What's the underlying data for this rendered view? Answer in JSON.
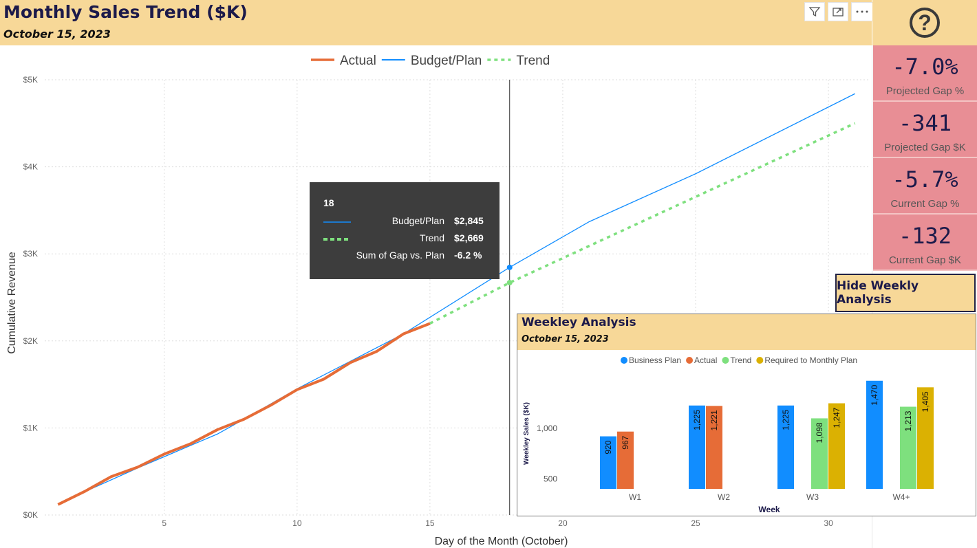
{
  "header": {
    "title": "Monthly Sales Trend ($K)",
    "subtitle": "October 15, 2023"
  },
  "toolbar": {
    "filter_icon": "filter-icon",
    "expand_icon": "focus-mode-icon",
    "more_icon": "more-options-icon"
  },
  "help": {
    "label": "?",
    "icon": "help-icon"
  },
  "kpis": [
    {
      "value": "-7.0%",
      "label": "Projected Gap %"
    },
    {
      "value": "-341",
      "label": "Projected Gap $K"
    },
    {
      "value": "-5.7%",
      "label": "Current Gap %"
    },
    {
      "value": "-132",
      "label": "Current Gap $K"
    }
  ],
  "hide_button": {
    "label": "Hide Weekly Analysis"
  },
  "tooltip": {
    "day": "18",
    "rows": [
      {
        "label": "Budget/Plan",
        "value": "$2,845"
      },
      {
        "label": "Trend",
        "value": "$2,669"
      },
      {
        "label": "Sum of Gap vs. Plan",
        "value": "-6.2 %"
      }
    ]
  },
  "colors": {
    "actual": "#e66c37",
    "plan": "#118dff",
    "trend": "#7ee07e",
    "required": "#dbb102",
    "header": "#f7d898",
    "kpi": "#e88e95"
  },
  "chart_data": [
    {
      "type": "line",
      "xlabel": "Day of the Month (October)",
      "ylabel": "Cumulative Revenue",
      "xlim": [
        0.5,
        31.5
      ],
      "ylim": [
        0,
        5000
      ],
      "x_ticks": [
        5,
        10,
        15,
        20,
        25,
        30
      ],
      "y_ticks": [
        {
          "value": 0,
          "label": "$0K"
        },
        {
          "value": 1000,
          "label": "$1K"
        },
        {
          "value": 2000,
          "label": "$2K"
        },
        {
          "value": 3000,
          "label": "$3K"
        },
        {
          "value": 4000,
          "label": "$4K"
        },
        {
          "value": 5000,
          "label": "$5K"
        }
      ],
      "grid": true,
      "legend": "top-center",
      "hover_day": 18,
      "series": [
        {
          "name": "Actual",
          "style": "solid-thick",
          "x": [
            1,
            2,
            3,
            4,
            5,
            6,
            7,
            8,
            9,
            10,
            11,
            12,
            13,
            14,
            15
          ],
          "values": [
            120,
            270,
            440,
            550,
            700,
            820,
            980,
            1100,
            1260,
            1440,
            1560,
            1750,
            1880,
            2080,
            2200
          ]
        },
        {
          "name": "Budget/Plan",
          "style": "solid",
          "x": [
            1,
            4,
            7,
            8,
            10,
            14,
            18,
            21,
            25,
            31
          ],
          "values": [
            130,
            540,
            930,
            1100,
            1450,
            2080,
            2845,
            3370,
            3920,
            4840
          ]
        },
        {
          "name": "Trend",
          "style": "dashed",
          "x": [
            15,
            18,
            31
          ],
          "values": [
            2200,
            2669,
            4500
          ]
        }
      ]
    },
    {
      "type": "bar",
      "title": "Weekley Analysis",
      "subtitle": "October 15, 2023",
      "xlabel": "Week",
      "ylabel": "Weekley Sales ($K)",
      "ylim": [
        400,
        1550
      ],
      "y_ticks": [
        500,
        1000
      ],
      "y_tick_labels": [
        "500",
        "1,000"
      ],
      "legend": "top-center",
      "categories": [
        "W1",
        "W2",
        "W3",
        "W4+"
      ],
      "series": [
        {
          "name": "Business Plan",
          "values": [
            920,
            1225,
            1225,
            1470
          ],
          "labels": [
            "920",
            "1,225",
            "1,225",
            "1,470"
          ]
        },
        {
          "name": "Actual",
          "values": [
            967,
            1221,
            null,
            null
          ],
          "labels": [
            "967",
            "1,221",
            "",
            ""
          ]
        },
        {
          "name": "Trend",
          "values": [
            null,
            null,
            1098,
            1213
          ],
          "labels": [
            "",
            "",
            "1,098",
            "1,213"
          ]
        },
        {
          "name": "Required to Monthly Plan",
          "values": [
            null,
            null,
            1247,
            1405
          ],
          "labels": [
            "",
            "",
            "1,247",
            "1,405"
          ]
        }
      ]
    }
  ]
}
